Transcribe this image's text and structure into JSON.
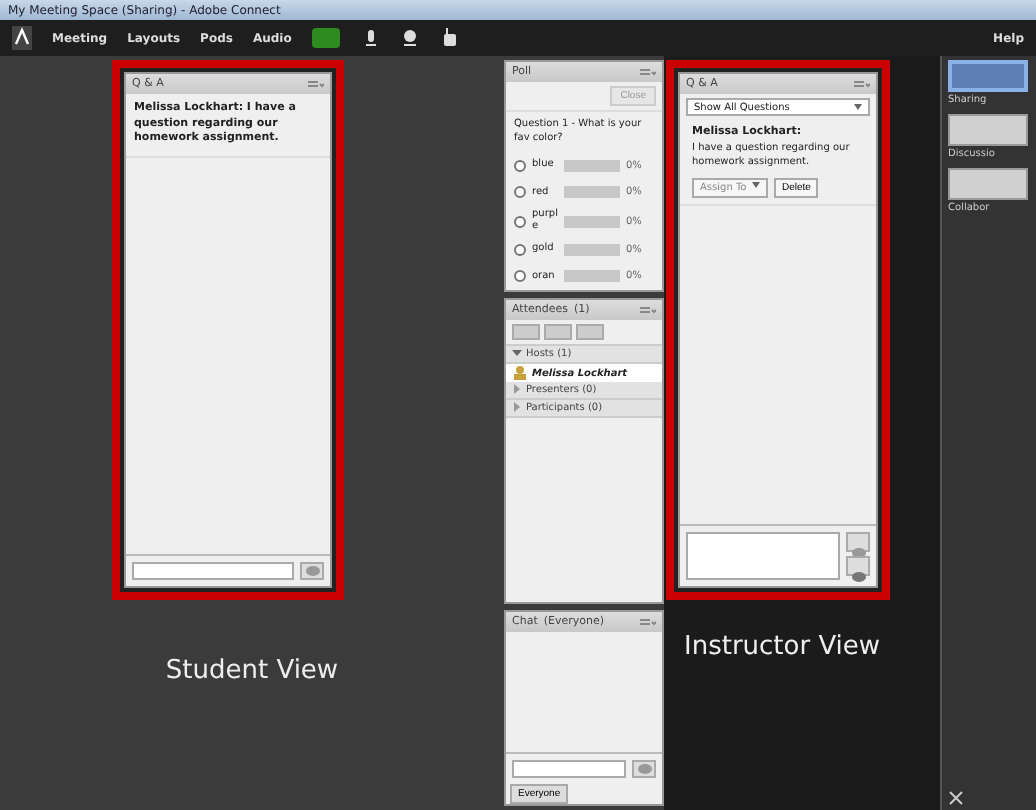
{
  "window": {
    "title": "My Meeting Space (Sharing) - Adobe Connect"
  },
  "menu": {
    "items": [
      "Meeting",
      "Layouts",
      "Pods",
      "Audio"
    ],
    "help": "Help",
    "speaker_on": true
  },
  "student_qa": {
    "title": "Q & A",
    "message": "Melissa Lockhart: I have a question regarding our homework assignment.",
    "caption": "Student View"
  },
  "poll": {
    "title": "Poll",
    "close": "Close",
    "question": "Question 1 - What is your fav color?",
    "options": [
      {
        "label": "blue",
        "selected": false,
        "percent": "0%"
      },
      {
        "label": "red",
        "selected": false,
        "percent": "0%"
      },
      {
        "label": "purple",
        "selected": false,
        "percent": "0%"
      },
      {
        "label": "gold",
        "selected": false,
        "percent": "0%"
      },
      {
        "label": "oran",
        "selected": false,
        "percent": "0%"
      }
    ]
  },
  "attendees": {
    "title": "Attendees",
    "count": "(1)",
    "groups": [
      {
        "label": "Hosts (1)",
        "expanded": true,
        "children": [
          {
            "name": "Melissa Lockhart"
          }
        ]
      },
      {
        "label": "Presenters (0)",
        "expanded": false
      },
      {
        "label": "Participants (0)",
        "expanded": false
      }
    ]
  },
  "chat": {
    "title": "Chat",
    "scope": "(Everyone)",
    "tab": "Everyone"
  },
  "instructor_qa": {
    "title": "Q & A",
    "filter": "Show All Questions",
    "asker": "Melissa Lockhart:",
    "question": "I have a question regarding our homework assignment.",
    "assign": "Assign To",
    "delete": "Delete",
    "caption": "Instructor View"
  },
  "layouts": [
    {
      "label": "Sharing",
      "selected": true
    },
    {
      "label": "Discussio",
      "selected": false
    },
    {
      "label": "Collabor",
      "selected": false
    }
  ]
}
